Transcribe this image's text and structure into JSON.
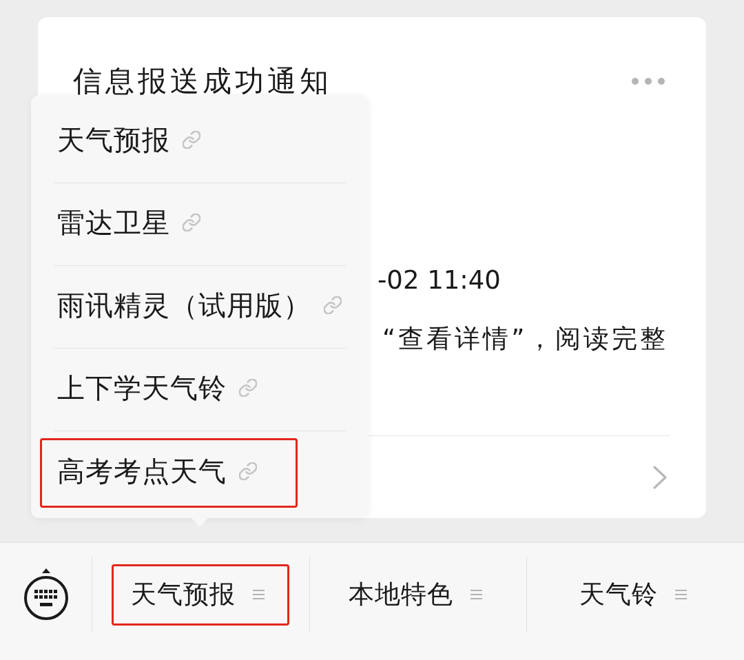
{
  "card": {
    "title": "信息报送成功通知",
    "lines": [
      "-02 11:40",
      "“查看详情”，阅读完整"
    ]
  },
  "menu": {
    "items": [
      {
        "label": "天气预报",
        "highlighted": false
      },
      {
        "label": "雷达卫星",
        "highlighted": false
      },
      {
        "label": "雨讯精灵（试用版）",
        "highlighted": false
      },
      {
        "label": "上下学天气铃",
        "highlighted": false
      },
      {
        "label": "高考考点天气",
        "highlighted": true
      }
    ]
  },
  "bottom_bar": {
    "tabs": [
      {
        "label": "天气预报",
        "highlighted": true
      },
      {
        "label": "本地特色",
        "highlighted": false
      },
      {
        "label": "天气铃",
        "highlighted": false
      }
    ]
  }
}
